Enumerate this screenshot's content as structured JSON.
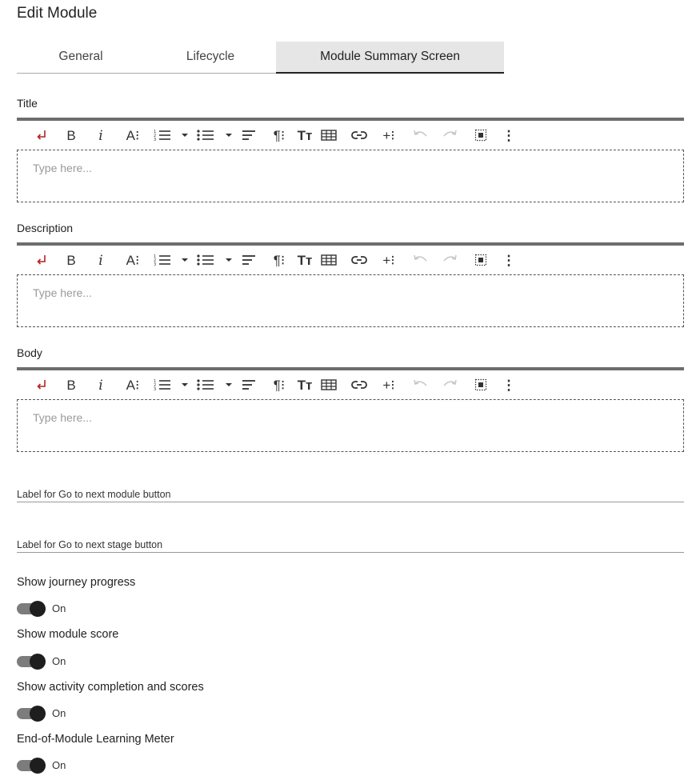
{
  "page": {
    "title": "Edit Module"
  },
  "tabs": [
    {
      "label": "General"
    },
    {
      "label": "Lifecycle"
    },
    {
      "label": "Module Summary Screen",
      "active": true
    }
  ],
  "editors": [
    {
      "label": "Title",
      "placeholder": "Type here..."
    },
    {
      "label": "Description",
      "placeholder": "Type here..."
    },
    {
      "label": "Body",
      "placeholder": "Type here..."
    }
  ],
  "toolbar_glyphs": {
    "bold": "B",
    "italic": "i",
    "font_size": "A⁝",
    "paragraph": "¶⁝",
    "text_transform": "Tт",
    "insert": "+⁝",
    "more": "⋮"
  },
  "toolbar_icons": [
    "return-icon",
    "bold-icon",
    "italic-icon",
    "font-size-icon",
    "ordered-list-icon",
    "dropdown-icon",
    "unordered-list-icon",
    "dropdown-icon",
    "align-icon",
    "paragraph-format-icon",
    "text-transform-icon",
    "table-icon",
    "link-icon",
    "insert-icon",
    "undo-icon",
    "redo-icon",
    "select-all-icon",
    "more-icon"
  ],
  "fields": [
    {
      "label": "Label for Go to next module button"
    },
    {
      "label": "Label for Go to next stage button"
    }
  ],
  "toggles": [
    {
      "label": "Show journey progress",
      "state": "On"
    },
    {
      "label": "Show module score",
      "state": "On"
    },
    {
      "label": "Show activity completion and scores",
      "state": "On"
    },
    {
      "label": "End-of-Module Learning Meter",
      "state": "On"
    }
  ],
  "colors": {
    "accent_return_icon": "#b22222",
    "toggle_thumb": "#1e1e1e",
    "toggle_track": "#7c7c7c",
    "active_tab_bg": "#e6e6e6"
  }
}
